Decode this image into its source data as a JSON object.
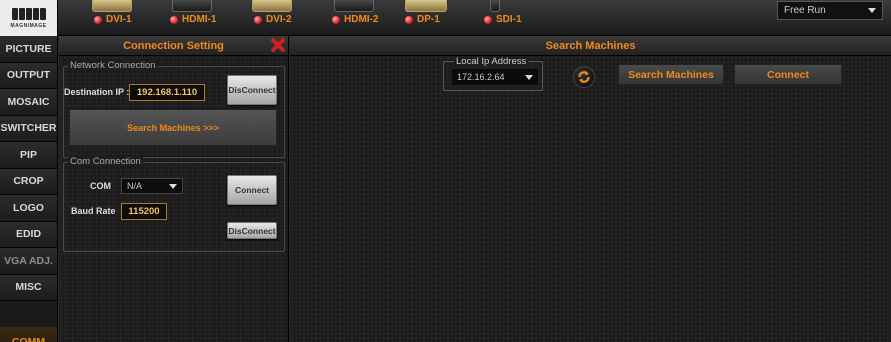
{
  "logo": {
    "text": "MAGNIMAGE"
  },
  "sources": [
    {
      "label": "DVI-1",
      "highlight": true
    },
    {
      "label": "HDMI-1",
      "highlight": false
    },
    {
      "label": "DVI-2",
      "highlight": true
    },
    {
      "label": "HDMI-2",
      "highlight": false
    },
    {
      "label": "DP-1",
      "highlight": true
    },
    {
      "label": "SDI-1",
      "highlight": false
    }
  ],
  "sync_mode": {
    "value": "Free Run"
  },
  "nav": {
    "items": [
      "PICTURE",
      "OUTPUT",
      "MOSAIC",
      "SWITCHER",
      "PIP",
      "CROP",
      "LOGO",
      "EDID",
      "VGA ADJ.",
      "MISC"
    ],
    "active": "COMM"
  },
  "connection_setting": {
    "title": "Connection Setting",
    "network": {
      "group_title": "Network Connection",
      "dest_ip_label": "Destination IP :",
      "dest_ip_value": "192.168.1.110",
      "disconnect_label": "DisConnect",
      "search_label": "Search Machines >>>"
    },
    "com": {
      "group_title": "Com Connection",
      "com_label": "COM",
      "com_value": "N/A",
      "baud_label": "Baud Rate",
      "baud_value": "115200",
      "connect_label": "Connect",
      "disconnect_label": "DisConnect"
    }
  },
  "search_machines": {
    "title": "Search Machines",
    "local_ip_label": "Local Ip Address",
    "local_ip_value": "172.16.2.64",
    "search_button": "Search Machines",
    "connect_button": "Connect"
  },
  "colors": {
    "accent": "#f08a1c",
    "status_led": "#e02020",
    "close": "#d02020"
  }
}
